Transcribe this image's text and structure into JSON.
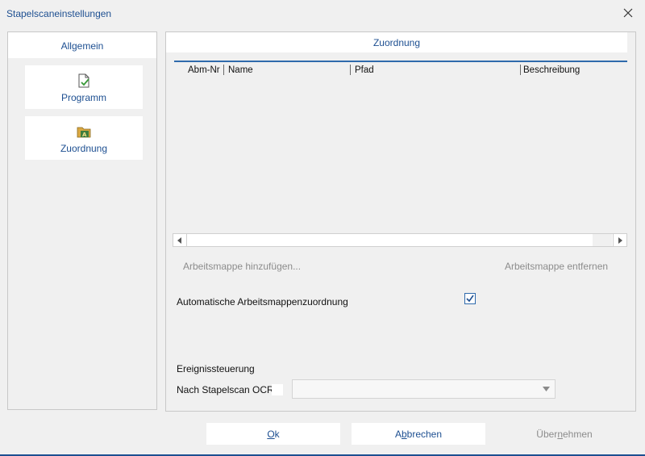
{
  "window": {
    "title": "Stapelscaneinstellungen",
    "close_icon": "close-icon"
  },
  "left_nav": {
    "tab_label": "Allgemein",
    "items": [
      {
        "label": "Programm",
        "icon": "document-check-icon"
      },
      {
        "label": "Zuordnung",
        "icon": "folder-a-icon"
      }
    ]
  },
  "right_panel": {
    "tab_label": "Zuordnung",
    "grid": {
      "columns": [
        "Abm-Nr",
        "Name",
        "Pfad",
        "Beschreibung"
      ],
      "rows": []
    },
    "add_workbook_label": "Arbeitsmappe hinzufügen...",
    "remove_workbook_label": "Arbeitsmappe entfernen",
    "auto_assign_label": "Automatische Arbeitsmappenzuordnung",
    "auto_assign_checked": true,
    "event_section_label": "Ereignissteuerung",
    "after_ocr_label": "Nach Stapelscan OCR",
    "after_ocr_checked": false,
    "after_ocr_select_value": ""
  },
  "buttons": {
    "ok_pre": "",
    "ok_u": "O",
    "ok_post": "k",
    "cancel_pre": "A",
    "cancel_u": "b",
    "cancel_post": "brechen",
    "apply_pre": "Über",
    "apply_u": "n",
    "apply_post": "ehmen"
  },
  "colors": {
    "accent": "#1d4f91",
    "grid_border": "#2f6aac",
    "disabled_text": "#8c8c8c"
  }
}
